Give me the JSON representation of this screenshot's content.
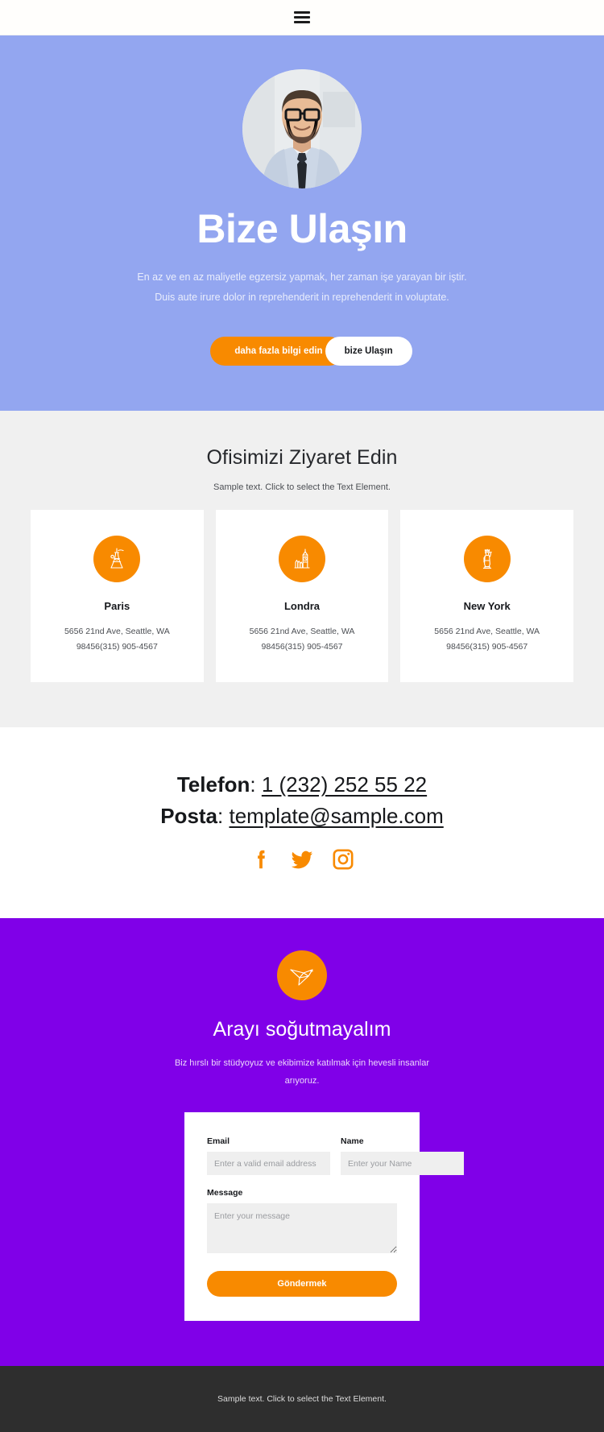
{
  "header": {
    "menu_icon": "hamburger-icon"
  },
  "hero": {
    "avatar_alt": "portrait-photo",
    "title": "Bize Ulaşın",
    "subtitle": "En az ve en az maliyetle egzersiz yapmak, her zaman işe yarayan bir iştir. Duis aute irure dolor in reprehenderit in reprehenderit in voluptate.",
    "primary_button": "daha fazla bilgi edin",
    "secondary_button": "bize Ulaşın",
    "background_color": "#93a6f0",
    "accent_color": "#f88a00"
  },
  "offices": {
    "title": "Ofisimizi Ziyaret Edin",
    "subtitle": "Sample text. Click to select the Text Element.",
    "cards": [
      {
        "icon": "eiffel-tower-icon",
        "name": "Paris",
        "address_line1": "5656 21nd Ave, Seattle, WA",
        "address_line2": "98456(315) 905-4567"
      },
      {
        "icon": "big-ben-icon",
        "name": "Londra",
        "address_line1": "5656 21nd Ave, Seattle, WA",
        "address_line2": "98456(315) 905-4567"
      },
      {
        "icon": "statue-of-liberty-icon",
        "name": "New York",
        "address_line1": "5656 21nd Ave, Seattle, WA",
        "address_line2": "98456(315) 905-4567"
      }
    ]
  },
  "contact": {
    "phone_label": "Telefon",
    "phone_value": "1 (232) 252 55 22 ",
    "email_label": "Posta",
    "email_value": "template@sample.com",
    "socials": [
      {
        "name": "facebook-icon"
      },
      {
        "name": "twitter-icon"
      },
      {
        "name": "instagram-icon"
      }
    ]
  },
  "cta": {
    "icon": "origami-bird-icon",
    "title": "Arayı soğutmayalım",
    "subtitle": "Biz hırslı bir stüdyoyuz ve ekibimize katılmak için hevesli insanlar arıyoruz.",
    "background_color": "#8000e8",
    "form": {
      "email_label": "Email",
      "email_placeholder": "Enter a valid email address",
      "name_label": "Name",
      "name_placeholder": "Enter your Name",
      "message_label": "Message",
      "message_placeholder": "Enter your message",
      "submit_label": "Göndermek"
    }
  },
  "footer": {
    "text": "Sample text. Click to select the Text Element."
  }
}
